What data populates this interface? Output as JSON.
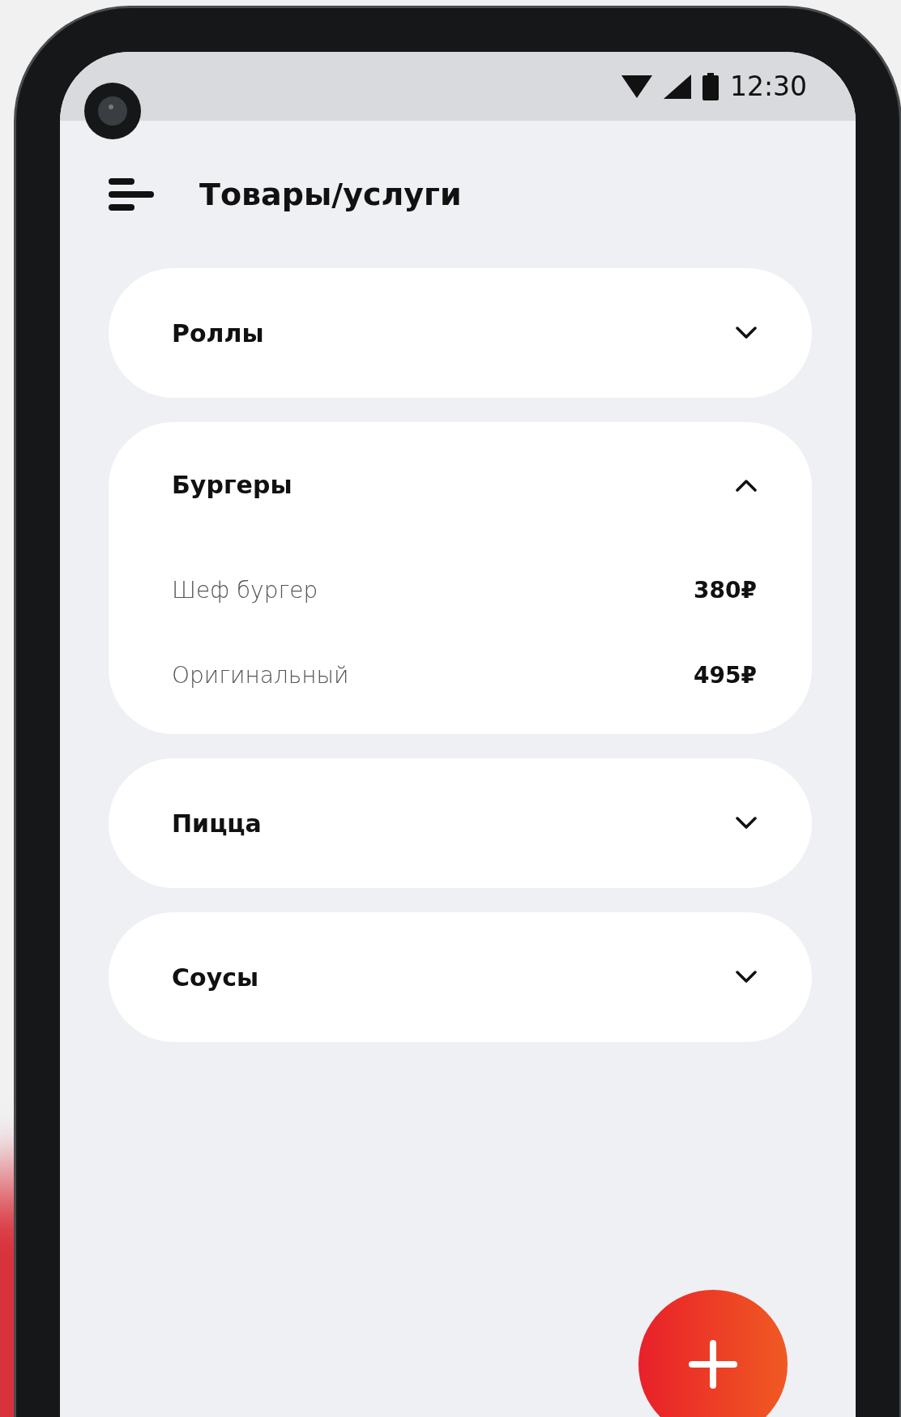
{
  "status_bar": {
    "time": "12:30"
  },
  "header": {
    "title": "Товары/услуги"
  },
  "categories": [
    {
      "name": "Роллы",
      "expanded": false
    },
    {
      "name": "Бургеры",
      "expanded": true,
      "items": [
        {
          "name": "Шеф бургер",
          "price": "380₽"
        },
        {
          "name": "Оригинальный",
          "price": "495₽"
        }
      ]
    },
    {
      "name": "Пицца",
      "expanded": false
    },
    {
      "name": "Соусы",
      "expanded": false
    }
  ]
}
